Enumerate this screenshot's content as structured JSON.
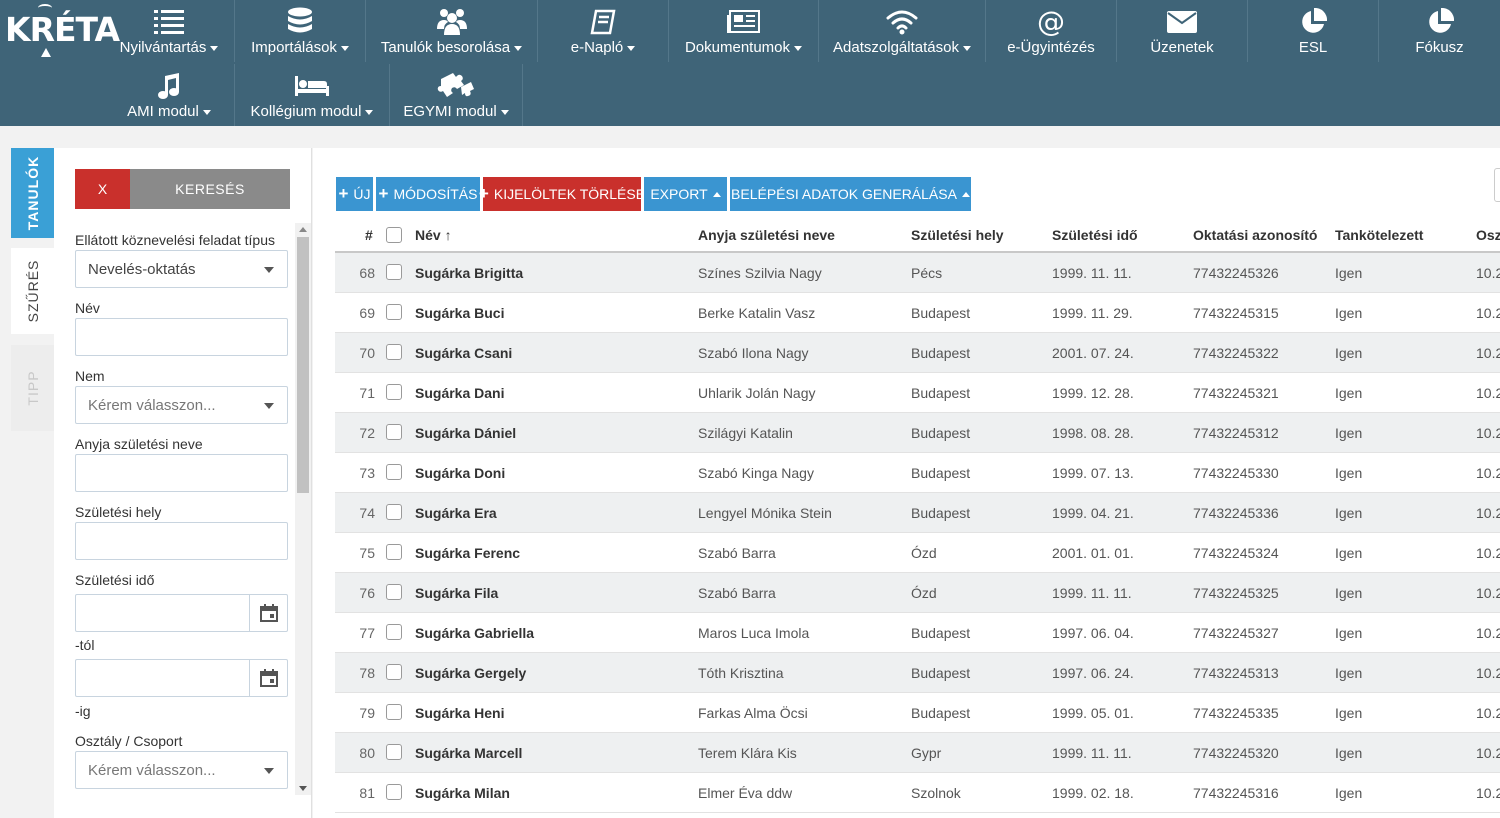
{
  "brand": {
    "logo_text": "KRÉTA"
  },
  "nav": [
    {
      "id": "nyilvantartas",
      "label": "Nyilvántartás",
      "icon": "list-icon",
      "dropdown": true
    },
    {
      "id": "importalasok",
      "label": "Importálások",
      "icon": "database-icon",
      "dropdown": true
    },
    {
      "id": "tanulok-besorolasa",
      "label": "Tanulók besorolása",
      "icon": "users-icon",
      "dropdown": true
    },
    {
      "id": "e-naplo",
      "label": "e-Napló",
      "icon": "book-icon",
      "dropdown": true
    },
    {
      "id": "dokumentumok",
      "label": "Dokumentumok",
      "icon": "newspaper-icon",
      "dropdown": true
    },
    {
      "id": "adatszolgaltatasok",
      "label": "Adatszolgáltatások",
      "icon": "wifi-icon",
      "dropdown": true
    },
    {
      "id": "e-ugyintezes",
      "label": "e-Ügyintézés",
      "icon": "at-icon",
      "dropdown": false
    },
    {
      "id": "uzenetek",
      "label": "Üzenetek",
      "icon": "envelope-icon",
      "dropdown": false
    },
    {
      "id": "esl",
      "label": "ESL",
      "icon": "pie-chart-icon",
      "dropdown": false
    },
    {
      "id": "fokusz",
      "label": "Fókusz",
      "icon": "pie-chart-icon",
      "dropdown": false
    },
    {
      "id": "ami-modul",
      "label": "AMI modul",
      "icon": "music-icon",
      "dropdown": true
    },
    {
      "id": "kollegium-modul",
      "label": "Kollégium modul",
      "icon": "bed-icon",
      "dropdown": true
    },
    {
      "id": "egymi-modul",
      "label": "EGYMI modul",
      "icon": "puzzle-icon",
      "dropdown": true
    }
  ],
  "side_tabs": {
    "tanulok": "TANULÓK",
    "szures": "SZŰRÉS",
    "tipp": "TIPP"
  },
  "filter": {
    "clear_label": "X",
    "search_label": "KERESÉS",
    "feladat_tipus_label": "Ellátott köznevelési feladat típus",
    "feladat_tipus_value": "Nevelés-oktatás",
    "nev_label": "Név",
    "nem_label": "Nem",
    "nem_placeholder": "Kérem válasszon...",
    "anyja_label": "Anyja születési neve",
    "szul_hely_label": "Születési hely",
    "szul_ido_label": "Születési idő",
    "tol_label": "-tól",
    "ig_label": "-ig",
    "osztaly_label": "Osztály / Csoport",
    "osztaly_placeholder": "Kérem válasszon..."
  },
  "toolbar": {
    "new_label": "ÚJ",
    "modify_label": "MÓDOSÍTÁS",
    "delete_label": "KIJELÖLTEK TÖRLÉSE",
    "export_label": "EXPORT",
    "login_gen_label": "BELÉPÉSI ADATOK GENERÁLÁSA"
  },
  "table": {
    "headers": {
      "num": "#",
      "nev": "Név",
      "sort_indicator": "↑",
      "anyja": "Anyja születési neve",
      "hely": "Születési hely",
      "ido": "Születési idő",
      "azon": "Oktatási azonosító",
      "tanko": "Tankötelezett",
      "osz": "Osz"
    },
    "rows": [
      {
        "num": "68",
        "nev": "Sugárka Brigitta",
        "anyja": "Színes Szilvia Nagy",
        "hely": "Pécs",
        "ido": "1999. 11. 11.",
        "azon": "77432245326",
        "tanko": "Igen",
        "osz": "10.2"
      },
      {
        "num": "69",
        "nev": "Sugárka Buci",
        "anyja": "Berke Katalin Vasz",
        "hely": "Budapest",
        "ido": "1999. 11. 29.",
        "azon": "77432245315",
        "tanko": "Igen",
        "osz": "10.2"
      },
      {
        "num": "70",
        "nev": "Sugárka Csani",
        "anyja": "Szabó Ilona Nagy",
        "hely": "Budapest",
        "ido": "2001. 07. 24.",
        "azon": "77432245322",
        "tanko": "Igen",
        "osz": "10.2"
      },
      {
        "num": "71",
        "nev": "Sugárka Dani",
        "anyja": "Uhlarik Jolán Nagy",
        "hely": "Budapest",
        "ido": "1999. 12. 28.",
        "azon": "77432245321",
        "tanko": "Igen",
        "osz": "10.2"
      },
      {
        "num": "72",
        "nev": "Sugárka Dániel",
        "anyja": "Szilágyi Katalin",
        "hely": "Budapest",
        "ido": "1998. 08. 28.",
        "azon": "77432245312",
        "tanko": "Igen",
        "osz": "10.2"
      },
      {
        "num": "73",
        "nev": "Sugárka Doni",
        "anyja": "Szabó Kinga Nagy",
        "hely": "Budapest",
        "ido": "1999. 07. 13.",
        "azon": "77432245330",
        "tanko": "Igen",
        "osz": "10.2"
      },
      {
        "num": "74",
        "nev": "Sugárka Era",
        "anyja": "Lengyel Mónika Stein",
        "hely": "Budapest",
        "ido": "1999. 04. 21.",
        "azon": "77432245336",
        "tanko": "Igen",
        "osz": "10.2"
      },
      {
        "num": "75",
        "nev": "Sugárka Ferenc",
        "anyja": "Szabó Barra",
        "hely": "Ózd",
        "ido": "2001. 01. 01.",
        "azon": "77432245324",
        "tanko": "Igen",
        "osz": "10.2"
      },
      {
        "num": "76",
        "nev": "Sugárka Fila",
        "anyja": "Szabó Barra",
        "hely": "Ózd",
        "ido": "1999. 11. 11.",
        "azon": "77432245325",
        "tanko": "Igen",
        "osz": "10.2"
      },
      {
        "num": "77",
        "nev": "Sugárka Gabriella",
        "anyja": "Maros Luca Imola",
        "hely": "Budapest",
        "ido": "1997. 06. 04.",
        "azon": "77432245327",
        "tanko": "Igen",
        "osz": "10.2"
      },
      {
        "num": "78",
        "nev": "Sugárka Gergely",
        "anyja": "Tóth Krisztina",
        "hely": "Budapest",
        "ido": "1997. 06. 24.",
        "azon": "77432245313",
        "tanko": "Igen",
        "osz": "10.2"
      },
      {
        "num": "79",
        "nev": "Sugárka Heni",
        "anyja": "Farkas Alma Öcsi",
        "hely": "Budapest",
        "ido": "1999. 05. 01.",
        "azon": "77432245335",
        "tanko": "Igen",
        "osz": "10.2"
      },
      {
        "num": "80",
        "nev": "Sugárka Marcell",
        "anyja": "Terem Klára Kis",
        "hely": "Gypr",
        "ido": "1999. 11. 11.",
        "azon": "77432245320",
        "tanko": "Igen",
        "osz": "10.2"
      },
      {
        "num": "81",
        "nev": "Sugárka Milan",
        "anyja": "Elmer Éva ddw",
        "hely": "Szolnok",
        "ido": "1999. 02. 18.",
        "azon": "77432245316",
        "tanko": "Igen",
        "osz": "10.2"
      }
    ]
  },
  "colors": {
    "topbar": "#3f6478",
    "primary": "#3a95d1",
    "danger": "#c9302c",
    "active_tab": "#3aa0d6"
  }
}
